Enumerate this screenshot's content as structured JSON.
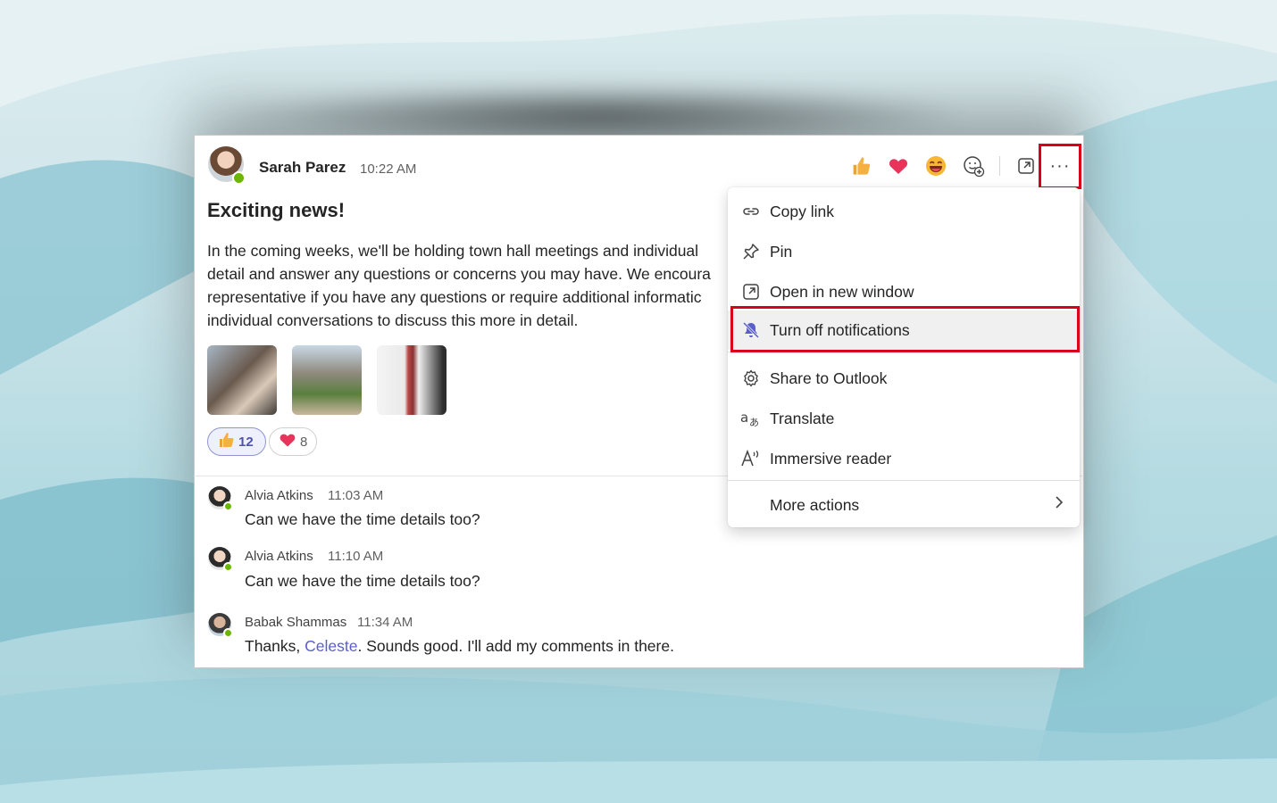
{
  "post": {
    "author": "Sarah Parez",
    "time": "10:22 AM",
    "title": "Exciting news!",
    "body_lines": [
      "In the coming weeks, we'll be holding town hall meetings and individual",
      "detail and answer any questions or concerns you may have. We encoura",
      "representative if you have any questions or require additional informatic",
      "individual conversations to discuss this more in detail."
    ],
    "reactions": [
      {
        "icon": "thumbs-up",
        "count": "12"
      },
      {
        "icon": "heart",
        "count": "8"
      }
    ]
  },
  "toolbar": {
    "reactions": [
      "thumbs-up",
      "heart",
      "laugh",
      "add-reaction"
    ],
    "more_glyph": "···"
  },
  "replies": [
    {
      "name": "Alvia Atkins",
      "time": "11:03 AM",
      "text": "Can we have the time details too?"
    },
    {
      "name": "Alvia Atkins",
      "time": "11:10 AM",
      "text": "Can we have the time details too?"
    },
    {
      "name": "Babak Shammas",
      "time": "11:34 AM",
      "text_before": "Thanks, ",
      "mention": "Celeste",
      "text_after": ". Sounds good. I'll add my comments in there."
    }
  ],
  "menu": {
    "items": [
      {
        "label": "Copy link",
        "icon": "link-icon"
      },
      {
        "label": "Pin",
        "icon": "pin-icon"
      },
      {
        "label": "Open in new window",
        "icon": "open-window-icon"
      },
      {
        "label": "Turn off notifications",
        "icon": "bell-off-icon",
        "highlighted": true
      },
      {
        "label": "Share to Outlook",
        "icon": "gear-icon"
      },
      {
        "label": "Translate",
        "icon": "translate-icon"
      },
      {
        "label": "Immersive reader",
        "icon": "immersive-reader-icon"
      },
      {
        "label": "More actions",
        "icon": "chevron-right-icon"
      }
    ]
  },
  "colors": {
    "accent": "#5b5fc7",
    "highlight_border": "#d9001b",
    "presence": "#6bb700"
  }
}
